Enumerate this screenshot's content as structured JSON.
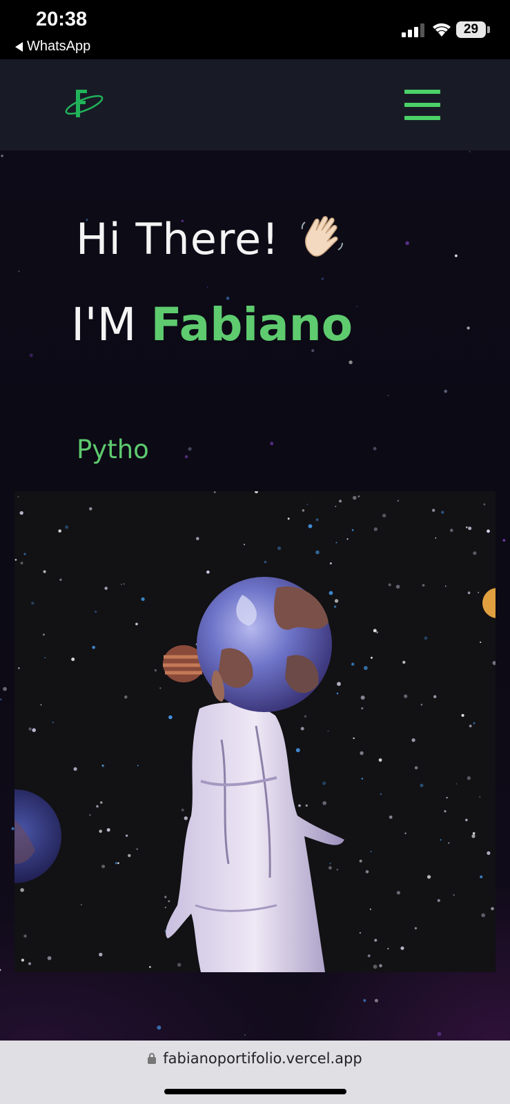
{
  "status_bar": {
    "time": "20:38",
    "back_app": "WhatsApp",
    "battery": "29"
  },
  "navbar": {
    "logo_icon": "logo-f-orbit-icon",
    "menu_icon": "hamburger-menu-icon",
    "accent_color": "#4bd168"
  },
  "hero": {
    "greeting": "Hi There!",
    "wave_icon": "waving-hand-icon",
    "intro_prefix": "I'M",
    "name": "Fabiano",
    "typed_text": "Pytho",
    "image": "astronaut-planet-head-illustration",
    "name_color": "#5ecb6f"
  },
  "browser": {
    "url": "fabianoportifolio.vercel.app"
  }
}
